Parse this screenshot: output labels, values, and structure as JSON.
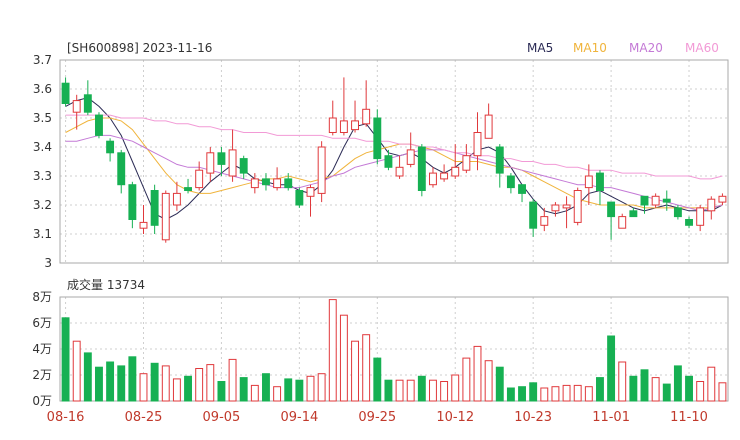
{
  "header": {
    "title": "[SH600898] 2023-11-16"
  },
  "legend": [
    {
      "label": "MA5",
      "color": "#2b2b55"
    },
    {
      "label": "MA10",
      "color": "#f0b43c"
    },
    {
      "label": "MA20",
      "color": "#c47ad6"
    },
    {
      "label": "MA60",
      "color": "#f29ad6"
    }
  ],
  "volume_panel": {
    "title": "成交量 13734"
  },
  "colors": {
    "up": "#e0383b",
    "down": "#16b052",
    "grid": "#cfcfcf",
    "axis": "#aaaaaa",
    "date": "#c0392b"
  },
  "chart_data": [
    {
      "type": "candlestick",
      "ylim": [
        3.0,
        3.7
      ],
      "yticks": [
        "3",
        "3.1",
        "3.2",
        "3.3",
        "3.4",
        "3.5",
        "3.6",
        "3.7"
      ],
      "xticks": [
        {
          "i": 0,
          "label": "08-16"
        },
        {
          "i": 7,
          "label": "08-25"
        },
        {
          "i": 14,
          "label": "09-05"
        },
        {
          "i": 21,
          "label": "09-14"
        },
        {
          "i": 28,
          "label": "09-25"
        },
        {
          "i": 35,
          "label": "10-12"
        },
        {
          "i": 42,
          "label": "10-23"
        },
        {
          "i": 49,
          "label": "11-01"
        },
        {
          "i": 56,
          "label": "11-10"
        }
      ],
      "candles": [
        [
          3.62,
          3.55,
          3.64,
          3.54
        ],
        [
          3.52,
          3.56,
          3.58,
          3.46
        ],
        [
          3.58,
          3.52,
          3.63,
          3.51
        ],
        [
          3.51,
          3.44,
          3.52,
          3.43
        ],
        [
          3.42,
          3.38,
          3.43,
          3.35
        ],
        [
          3.38,
          3.27,
          3.39,
          3.24
        ],
        [
          3.27,
          3.15,
          3.28,
          3.12
        ],
        [
          3.12,
          3.14,
          3.2,
          3.1
        ],
        [
          3.25,
          3.13,
          3.27,
          3.1
        ],
        [
          3.08,
          3.24,
          3.25,
          3.07
        ],
        [
          3.2,
          3.24,
          3.28,
          3.18
        ],
        [
          3.26,
          3.25,
          3.29,
          3.24
        ],
        [
          3.26,
          3.32,
          3.35,
          3.25
        ],
        [
          3.31,
          3.38,
          3.4,
          3.28
        ],
        [
          3.38,
          3.34,
          3.4,
          3.3
        ],
        [
          3.3,
          3.39,
          3.46,
          3.28
        ],
        [
          3.36,
          3.31,
          3.37,
          3.29
        ],
        [
          3.26,
          3.29,
          3.31,
          3.24
        ],
        [
          3.29,
          3.27,
          3.31,
          3.25
        ],
        [
          3.26,
          3.29,
          3.33,
          3.25
        ],
        [
          3.29,
          3.26,
          3.31,
          3.25
        ],
        [
          3.25,
          3.2,
          3.26,
          3.19
        ],
        [
          3.23,
          3.26,
          3.27,
          3.16
        ],
        [
          3.24,
          3.4,
          3.42,
          3.21
        ],
        [
          3.45,
          3.5,
          3.56,
          3.44
        ],
        [
          3.45,
          3.49,
          3.64,
          3.44
        ],
        [
          3.46,
          3.49,
          3.56,
          3.45
        ],
        [
          3.48,
          3.53,
          3.63,
          3.47
        ],
        [
          3.5,
          3.36,
          3.53,
          3.34
        ],
        [
          3.37,
          3.33,
          3.39,
          3.32
        ],
        [
          3.3,
          3.33,
          3.37,
          3.29
        ],
        [
          3.34,
          3.39,
          3.45,
          3.33
        ],
        [
          3.4,
          3.25,
          3.41,
          3.23
        ],
        [
          3.27,
          3.31,
          3.33,
          3.26
        ],
        [
          3.29,
          3.31,
          3.34,
          3.28
        ],
        [
          3.3,
          3.33,
          3.41,
          3.29
        ],
        [
          3.32,
          3.37,
          3.41,
          3.31
        ],
        [
          3.37,
          3.45,
          3.52,
          3.32
        ],
        [
          3.43,
          3.51,
          3.55,
          3.43
        ],
        [
          3.4,
          3.31,
          3.41,
          3.26
        ],
        [
          3.3,
          3.26,
          3.31,
          3.24
        ],
        [
          3.27,
          3.24,
          3.27,
          3.21
        ],
        [
          3.21,
          3.12,
          3.22,
          3.09
        ],
        [
          3.13,
          3.16,
          3.19,
          3.11
        ],
        [
          3.18,
          3.2,
          3.21,
          3.16
        ],
        [
          3.19,
          3.2,
          3.23,
          3.12
        ],
        [
          3.14,
          3.25,
          3.26,
          3.13
        ],
        [
          3.26,
          3.3,
          3.34,
          3.2
        ],
        [
          3.31,
          3.25,
          3.32,
          3.2
        ],
        [
          3.21,
          3.16,
          3.21,
          3.08
        ],
        [
          3.12,
          3.16,
          3.17,
          3.12
        ],
        [
          3.18,
          3.16,
          3.19,
          3.16
        ],
        [
          3.23,
          3.2,
          3.23,
          3.17
        ],
        [
          3.2,
          3.23,
          3.24,
          3.19
        ],
        [
          3.22,
          3.21,
          3.25,
          3.18
        ],
        [
          3.19,
          3.16,
          3.2,
          3.15
        ],
        [
          3.15,
          3.13,
          3.16,
          3.12
        ],
        [
          3.13,
          3.19,
          3.2,
          3.11
        ],
        [
          3.18,
          3.22,
          3.23,
          3.15
        ],
        [
          3.21,
          3.23,
          3.24,
          3.2
        ]
      ],
      "series": [
        {
          "name": "MA5",
          "values": [
            3.54,
            3.56,
            3.57,
            3.54,
            3.5,
            3.44,
            3.35,
            3.26,
            3.17,
            3.15,
            3.17,
            3.2,
            3.24,
            3.28,
            3.31,
            3.34,
            3.32,
            3.29,
            3.28,
            3.27,
            3.27,
            3.25,
            3.24,
            3.27,
            3.32,
            3.4,
            3.47,
            3.48,
            3.43,
            3.38,
            3.37,
            3.38,
            3.36,
            3.33,
            3.31,
            3.33,
            3.36,
            3.39,
            3.4,
            3.38,
            3.33,
            3.27,
            3.22,
            3.18,
            3.17,
            3.18,
            3.2,
            3.24,
            3.25,
            3.23,
            3.21,
            3.19,
            3.18,
            3.19,
            3.2,
            3.19,
            3.18,
            3.18,
            3.18,
            3.2
          ]
        },
        {
          "name": "MA10",
          "values": [
            3.45,
            3.47,
            3.49,
            3.5,
            3.5,
            3.49,
            3.46,
            3.41,
            3.36,
            3.31,
            3.27,
            3.25,
            3.24,
            3.24,
            3.25,
            3.26,
            3.27,
            3.28,
            3.29,
            3.29,
            3.3,
            3.29,
            3.28,
            3.29,
            3.3,
            3.33,
            3.36,
            3.38,
            3.39,
            3.4,
            3.41,
            3.41,
            3.4,
            3.39,
            3.37,
            3.35,
            3.35,
            3.35,
            3.34,
            3.33,
            3.33,
            3.32,
            3.3,
            3.28,
            3.26,
            3.24,
            3.22,
            3.21,
            3.2,
            3.2,
            3.2,
            3.2,
            3.19,
            3.19,
            3.19,
            3.19,
            3.19,
            3.19,
            3.19,
            3.2
          ]
        },
        {
          "name": "MA20",
          "values": [
            3.42,
            3.42,
            3.43,
            3.44,
            3.44,
            3.43,
            3.42,
            3.4,
            3.38,
            3.36,
            3.34,
            3.33,
            3.33,
            3.32,
            3.31,
            3.3,
            3.29,
            3.28,
            3.27,
            3.26,
            3.26,
            3.26,
            3.27,
            3.28,
            3.3,
            3.31,
            3.33,
            3.34,
            3.35,
            3.36,
            3.37,
            3.38,
            3.39,
            3.39,
            3.39,
            3.38,
            3.37,
            3.36,
            3.35,
            3.34,
            3.33,
            3.32,
            3.31,
            3.3,
            3.29,
            3.28,
            3.27,
            3.27,
            3.26,
            3.26,
            3.25,
            3.24,
            3.23,
            3.22,
            3.21,
            3.2,
            3.19,
            3.18,
            3.19,
            3.2
          ]
        },
        {
          "name": "MA60",
          "values": [
            3.51,
            3.51,
            3.51,
            3.51,
            3.51,
            3.5,
            3.5,
            3.5,
            3.49,
            3.49,
            3.48,
            3.48,
            3.47,
            3.47,
            3.46,
            3.46,
            3.45,
            3.45,
            3.45,
            3.44,
            3.44,
            3.44,
            3.44,
            3.44,
            3.43,
            3.43,
            3.43,
            3.42,
            3.42,
            3.42,
            3.41,
            3.41,
            3.4,
            3.4,
            3.39,
            3.38,
            3.38,
            3.37,
            3.37,
            3.36,
            3.36,
            3.35,
            3.35,
            3.34,
            3.34,
            3.33,
            3.33,
            3.32,
            3.32,
            3.32,
            3.31,
            3.31,
            3.31,
            3.3,
            3.3,
            3.3,
            3.3,
            3.29,
            3.29,
            3.3
          ]
        }
      ]
    },
    {
      "type": "bar",
      "yticks": [
        "0万",
        "2万",
        "4万",
        "6万",
        "8万"
      ],
      "ylim": [
        0,
        80000
      ],
      "values": [
        64000,
        46000,
        37000,
        26000,
        30000,
        27000,
        34000,
        21000,
        29000,
        27000,
        17000,
        19000,
        25000,
        28000,
        15000,
        32000,
        18000,
        12000,
        21000,
        11000,
        17000,
        16000,
        19000,
        21000,
        78000,
        66000,
        46000,
        51000,
        33000,
        16000,
        16000,
        16000,
        19000,
        16000,
        15000,
        20000,
        33000,
        42000,
        31000,
        26000,
        10000,
        11000,
        14000,
        10000,
        11000,
        12000,
        12000,
        11000,
        18000,
        50000,
        30000,
        19000,
        24000,
        18000,
        13000,
        27000,
        19000,
        15000,
        26000,
        14000
      ]
    }
  ]
}
